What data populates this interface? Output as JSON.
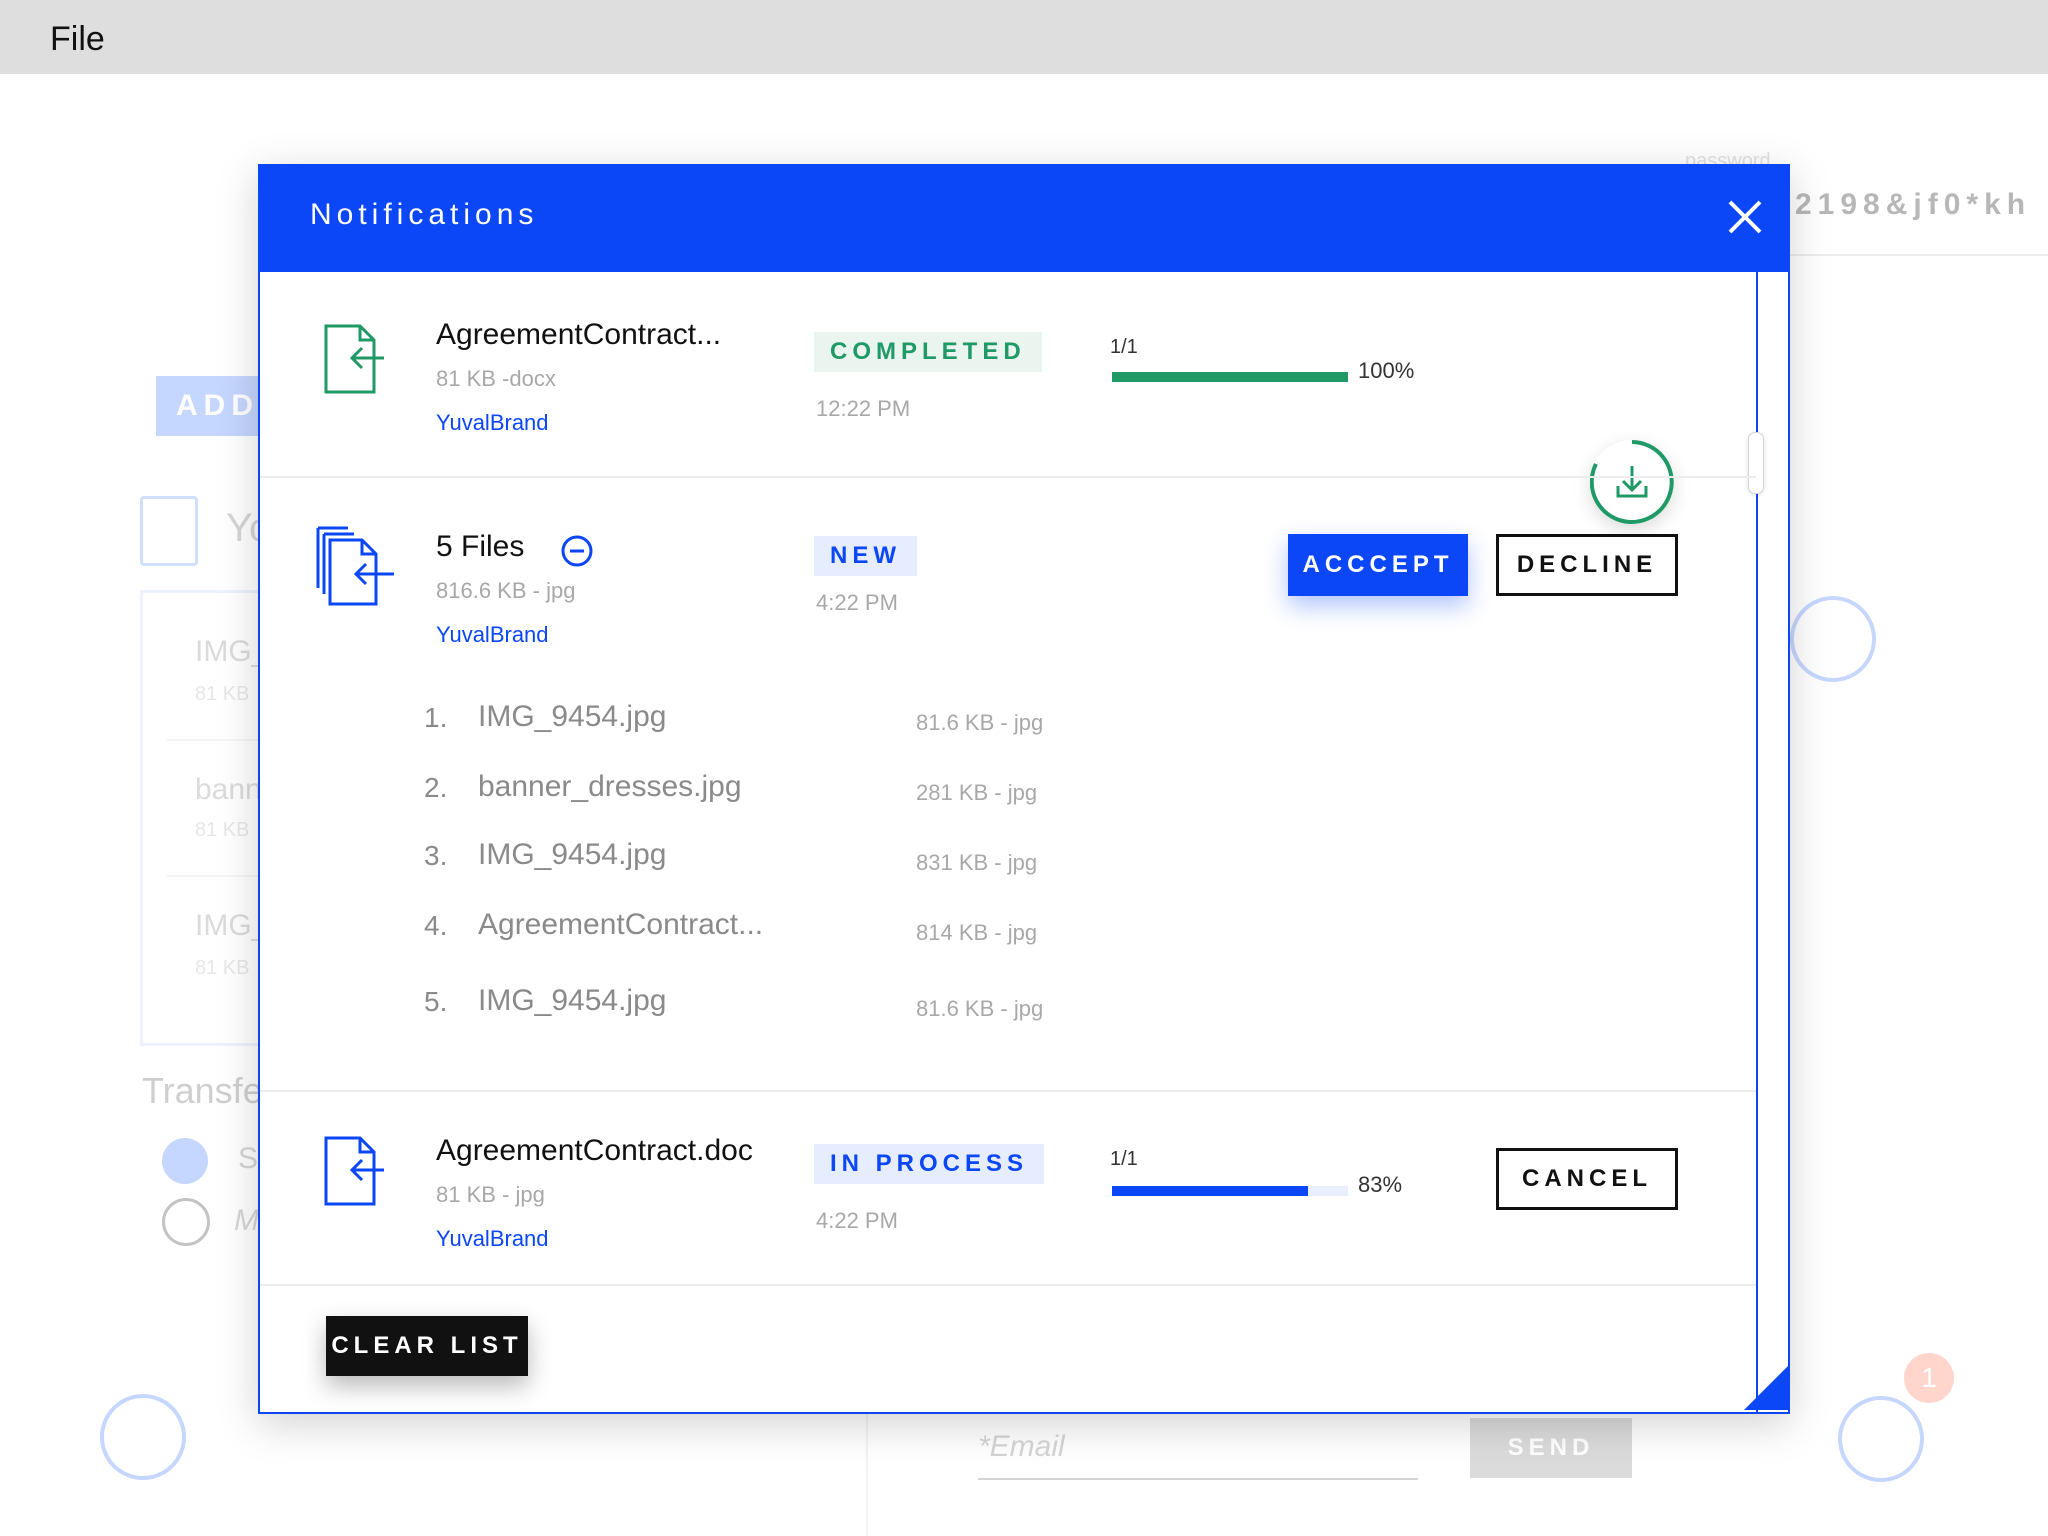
{
  "menubar": {
    "file_label": "File"
  },
  "background": {
    "add_label": "ADD",
    "y_partial": "Yo",
    "list_items": [
      {
        "name": "IMG_",
        "meta": "81 KB"
      },
      {
        "name": "bann",
        "meta": "81 KB"
      },
      {
        "name": "IMG_",
        "meta": "81 KB"
      }
    ],
    "transfer_label": "Transfe",
    "radio_labels": [
      "S",
      "M"
    ],
    "password_label": "password",
    "password_value": "2198&jf0*kh",
    "badge_count": "1",
    "email_placeholder": "*Email",
    "send_label": "SEND"
  },
  "modal": {
    "title": "Notifications",
    "rows": [
      {
        "file_name": "AgreementContract...",
        "meta": "81 KB -docx",
        "user": "YuvalBrand",
        "status": "COMPLETED",
        "time": "12:22 PM",
        "progress_count": "1/1",
        "progress_pct": "100%",
        "progress_value": 1.0
      },
      {
        "file_name": "5 Files",
        "meta": "816.6 KB - jpg",
        "user": "YuvalBrand",
        "status": "NEW",
        "time": "4:22 PM",
        "accept_label": "ACCCEPT",
        "decline_label": "DECLINE",
        "files": [
          {
            "num": "1.",
            "name": "IMG_9454.jpg",
            "meta": "81.6 KB - jpg"
          },
          {
            "num": "2.",
            "name": "banner_dresses.jpg",
            "meta": "281 KB - jpg"
          },
          {
            "num": "3.",
            "name": "IMG_9454.jpg",
            "meta": "831 KB - jpg"
          },
          {
            "num": "4.",
            "name": "AgreementContract...",
            "meta": "814 KB - jpg"
          },
          {
            "num": "5.",
            "name": "IMG_9454.jpg",
            "meta": "81.6 KB - jpg"
          }
        ]
      },
      {
        "file_name": "AgreementContract.doc",
        "meta": "81 KB - jpg",
        "user": "YuvalBrand",
        "status": "IN PROCESS",
        "time": "4:22 PM",
        "progress_count": "1/1",
        "progress_pct": "83%",
        "progress_value": 0.83,
        "cancel_label": "CANCEL"
      }
    ],
    "clear_label": "CLEAR LIST"
  },
  "colors": {
    "accent": "#0b47f7",
    "success": "#1f9a67",
    "header_bg": "#dedede"
  }
}
